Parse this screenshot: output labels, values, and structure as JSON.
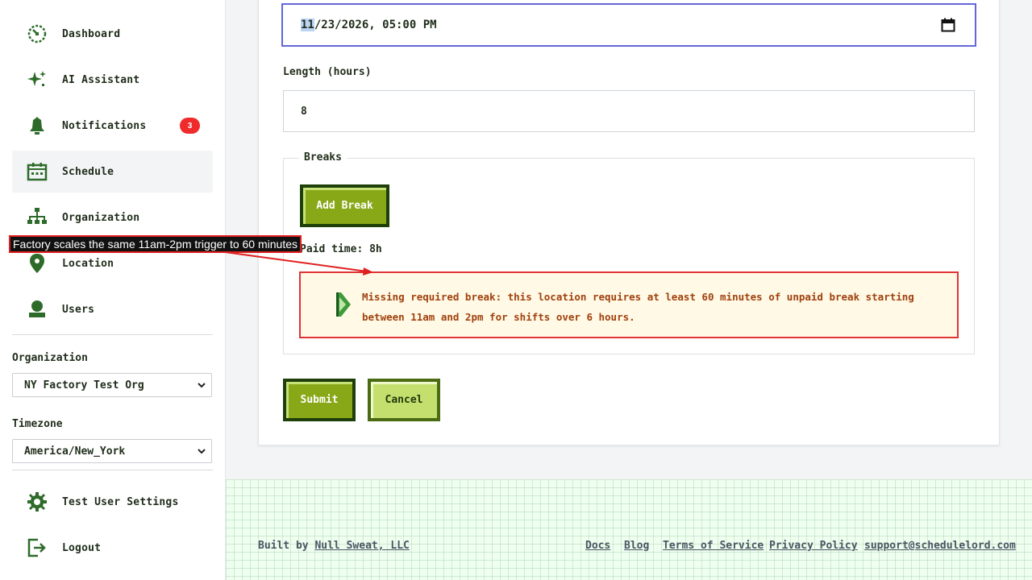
{
  "sidebar": {
    "items": [
      {
        "label": "Dashboard",
        "icon": "dashboard-icon"
      },
      {
        "label": "AI Assistant",
        "icon": "sparkle-icon"
      },
      {
        "label": "Notifications",
        "icon": "bell-icon",
        "badge": "3"
      },
      {
        "label": "Schedule",
        "icon": "calendar-icon",
        "active": true
      },
      {
        "label": "Organization",
        "icon": "org-chart-icon"
      },
      {
        "label": "Location",
        "icon": "location-pin-icon"
      },
      {
        "label": "Users",
        "icon": "user-icon"
      }
    ],
    "organization_label": "Organization",
    "organization_value": "NY Factory Test Org",
    "timezone_label": "Timezone",
    "timezone_value": "America/New_York",
    "settings_label": "Test User Settings",
    "logout_label": "Logout"
  },
  "form": {
    "datetime_month": "11",
    "datetime_rest": "/23/2026, 05:00 PM",
    "length_label": "Length (hours)",
    "length_value": "8",
    "breaks_legend": "Breaks",
    "add_break_label": "Add Break",
    "paid_time": "Paid time: 8h",
    "warning": "Missing required break: this location requires at least 60 minutes of unpaid break starting between 11am and 2pm for shifts over 6 hours.",
    "submit_label": "Submit",
    "cancel_label": "Cancel"
  },
  "annotation": {
    "text": "Factory scales the same 11am-2pm trigger to 60 minutes"
  },
  "footer": {
    "built_by": "Built by ",
    "company": "Null Sweat, LLC",
    "links": [
      "Docs",
      "Blog",
      "Terms of Service",
      "Privacy Policy",
      "support@schedulelord.com"
    ]
  },
  "colors": {
    "accent_dark": "#1e3f0a",
    "accent_green": "#88a818",
    "warning_border": "#e03434",
    "focus_border": "#6366d9",
    "badge_red": "#ef2b2b"
  }
}
